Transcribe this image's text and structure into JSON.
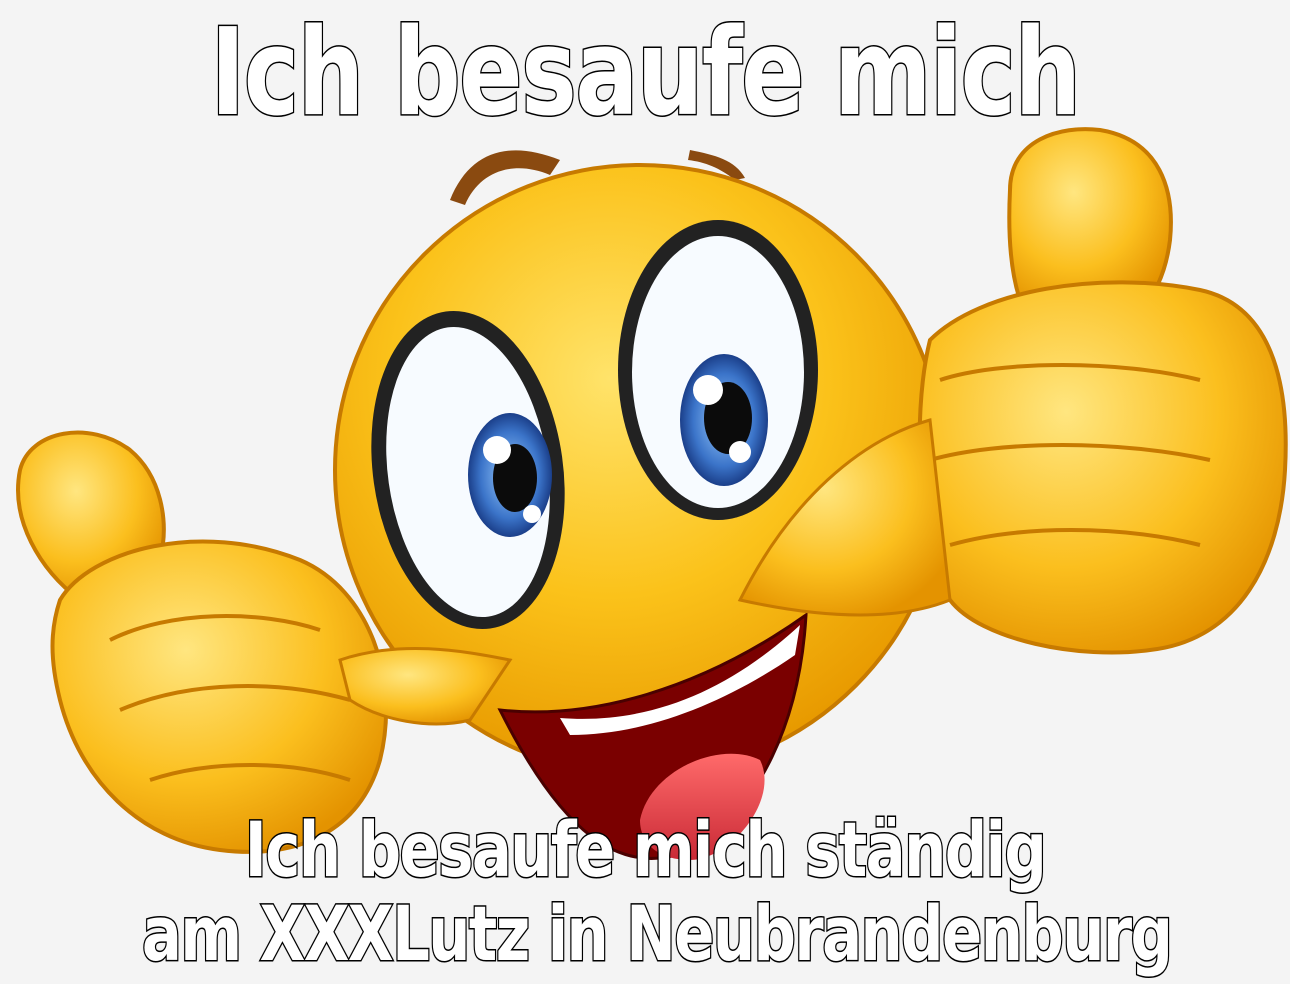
{
  "meme": {
    "top_text": "Ich besaufe mich",
    "bottom_text": {
      "line1": "Ich besaufe mich ständig",
      "line2": "am XXXLutz in Neubrandenburg"
    }
  },
  "image": {
    "subject": "smiley-thumbs-up-emoji",
    "colors": {
      "face": "#f7b500",
      "outline": "#c77a00",
      "iris": "#2f63b8",
      "mouth": "#7a0000",
      "tongue": "#e8474c",
      "background": "#f4f4f4"
    }
  }
}
